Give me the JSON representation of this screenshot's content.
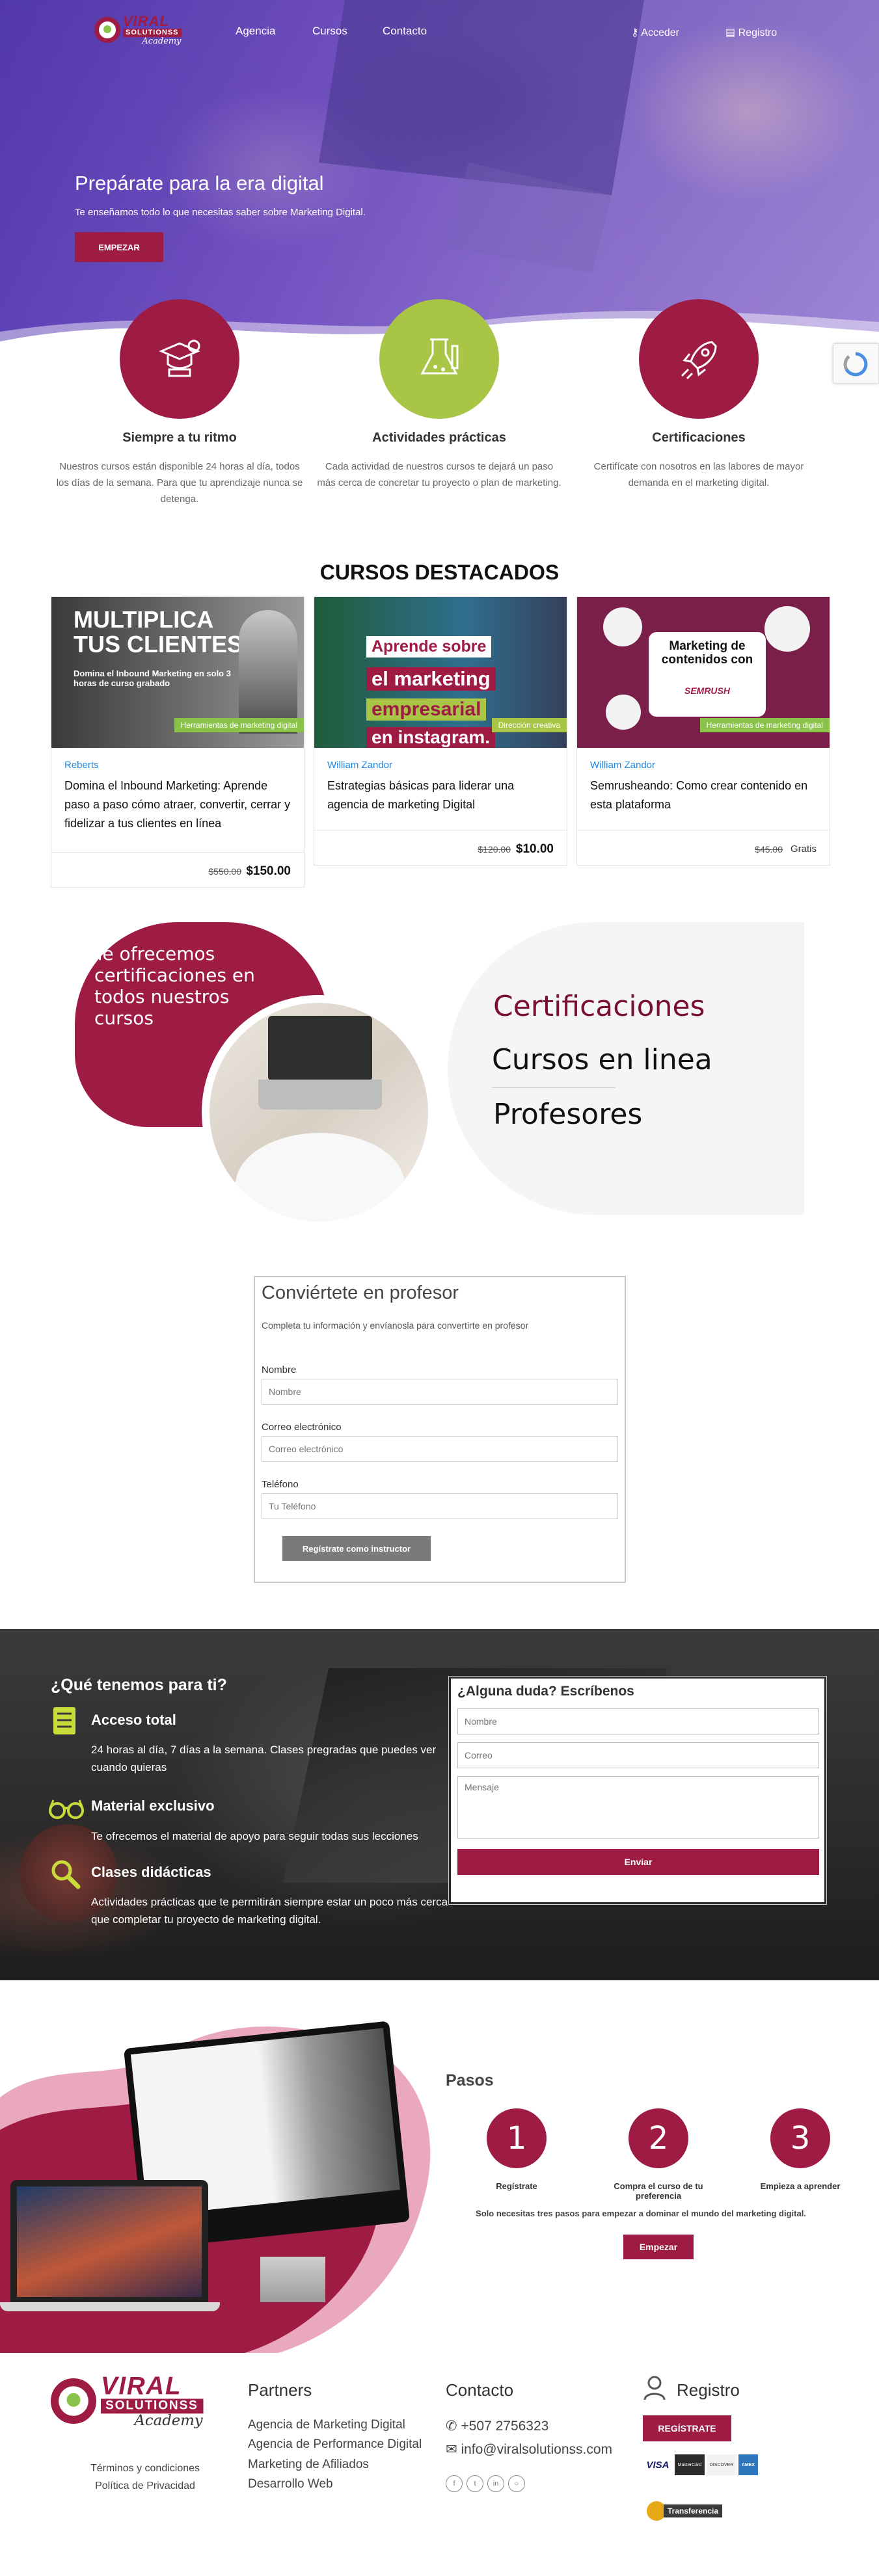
{
  "nav": {
    "logo": {
      "line1": "VIRAL",
      "line2": "SOLUTIONSS",
      "line3": "Academy"
    },
    "links": [
      "Agencia",
      "Cursos",
      "Contacto"
    ],
    "login": "Acceder",
    "register": "Registro"
  },
  "hero": {
    "title": "Prepárate para la era digital",
    "subtitle": "Te enseñamos todo lo que necesitas saber sobre Marketing Digital.",
    "button": "EMPEZAR"
  },
  "features": [
    {
      "icon": "mortarboard-icon",
      "color": "#9e1b44",
      "title": "Siempre a tu ritmo",
      "text": "Nuestros cursos están disponible 24 horas al día, todos los días de la semana. Para que tu aprendizaje nunca se detenga."
    },
    {
      "icon": "lab-flask-icon",
      "color": "#a8c545",
      "title": "Actividades prácticas",
      "text": "Cada actividad de nuestros cursos te dejará un paso más cerca de concretar tu proyecto o plan de marketing."
    },
    {
      "icon": "rocket-icon",
      "color": "#9e1b44",
      "title": "Certificaciones",
      "text": "Certifícate con nosotros en las labores de mayor demanda en el marketing digital."
    }
  ],
  "courses": {
    "title": "CURSOS DESTACADOS",
    "items": [
      {
        "img_text1": "MULTIPLICA",
        "img_text2": "TUS CLIENTES",
        "img_sub": "Domina el Inbound Marketing en solo 3 horas de curso grabado",
        "tag": "Herramientas de marketing digital",
        "author": "Reberts",
        "title": "Domina el Inbound Marketing: Aprende paso a paso cómo atraer, convertir, cerrar y fidelizar a tus clientes en línea",
        "old_price": "$550.00",
        "new_price": "$150.00"
      },
      {
        "img_text1": "Aprende sobre",
        "img_text2": "el marketing",
        "img_text3": "empresarial",
        "img_text4": "en instagram.",
        "tag": "Dirección creativa",
        "author": "William Zandor",
        "title": "Estrategias básicas para liderar una agencia de marketing Digital",
        "old_price": "$120.00",
        "new_price": "$10.00"
      },
      {
        "img_text1": "Marketing de",
        "img_text2": "contenidos con",
        "img_brand": "SEMRUSH",
        "tag": "Herramientas de marketing digital",
        "author": "William Zandor",
        "title": "Semrusheando: Como crear contenido en esta plataforma",
        "old_price": "$45.00",
        "new_price": "Gratis"
      }
    ]
  },
  "certs": {
    "lead": "Te ofrecemos certificaciones en todos nuestros cursos",
    "items": [
      "Certificaciones",
      "Cursos en linea",
      "Profesores"
    ],
    "colors": {
      "first": "#7a1030",
      "rest": "#111111"
    }
  },
  "teacher_form": {
    "title": "Conviértete en profesor",
    "subtitle": "Completa tu información y envíanosla para convertirte en profesor",
    "name_label": "Nombre",
    "name_placeholder": "Nombre",
    "email_label": "Correo electrónico",
    "email_placeholder": "Correo electrónico",
    "phone_label": "Teléfono",
    "phone_placeholder": "Tu Teléfono",
    "button": "Regístrate como instructor"
  },
  "offer": {
    "title": "¿Qué tenemos para ti?",
    "items": [
      {
        "icon": "book-icon",
        "title": "Acceso total",
        "text": "24 horas al día, 7 días a la semana. Clases pregradas que puedes ver cuando quieras"
      },
      {
        "icon": "glasses-icon",
        "title": "Material exclusivo",
        "text": "Te ofrecemos el material de apoyo para seguir todas sus lecciones"
      },
      {
        "icon": "magnifier-icon",
        "title": "Clases didácticas",
        "text": "Actividades prácticas que te permitirán siempre estar un poco más cerca que completar tu proyecto de marketing digital."
      }
    ]
  },
  "contact_form": {
    "title": "¿Alguna duda? Escríbenos",
    "name_placeholder": "Nombre",
    "email_placeholder": "Correo",
    "message_placeholder": "Mensaje",
    "button": "Enviar"
  },
  "steps": {
    "title": "Pasos",
    "items": [
      {
        "number": "1",
        "label": "Regístrate"
      },
      {
        "number": "2",
        "label": "Compra el curso de tu preferencia"
      },
      {
        "number": "3",
        "label": "Empieza a aprender"
      }
    ],
    "note": "Solo necesitas tres pasos para empezar a dominar el mundo del marketing digital.",
    "button": "Empezar"
  },
  "footer": {
    "legal": [
      "Términos y condiciones",
      "Política de Privacidad"
    ],
    "partners_title": "Partners",
    "partners": [
      "Agencia de Marketing Digital",
      "Agencia de Performance Digital",
      "Marketing de Afiliados",
      "Desarrollo Web"
    ],
    "contact_title": "Contacto",
    "phone": "+507 2756323",
    "email": "info@viralsolutionss.com",
    "register_title": "Registro",
    "register_button": "REGÍSTRATE",
    "payment_cards": [
      "VISA",
      "MasterCard",
      "DISCOVER",
      "AMEX"
    ],
    "transfer": "Transferencia"
  },
  "colors": {
    "accent": "#9e1b44",
    "green": "#a8c545",
    "tag_green": "#8bc34a",
    "link_blue": "#1e88e5"
  }
}
